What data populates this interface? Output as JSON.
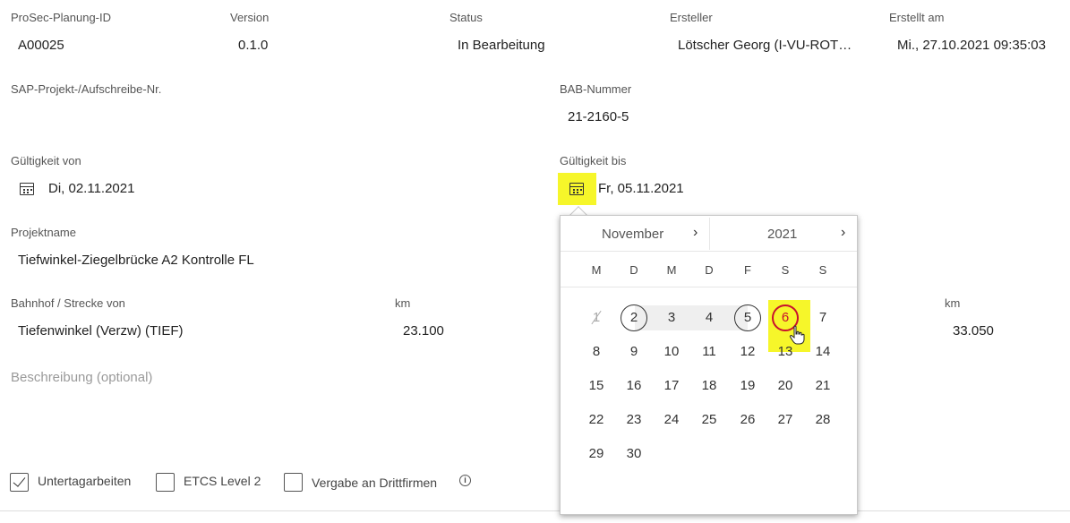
{
  "header_fields": {
    "planning_id": {
      "label": "ProSec-Planung-ID",
      "value": "A00025"
    },
    "version": {
      "label": "Version",
      "value": "0.1.0"
    },
    "status": {
      "label": "Status",
      "value": "In Bearbeitung"
    },
    "creator": {
      "label": "Ersteller",
      "value": "Lötscher Georg (I-VU-ROT…"
    },
    "created_at": {
      "label": "Erstellt am",
      "value": "Mi., 27.10.2021 09:35:03"
    }
  },
  "sap": {
    "label": "SAP-Projekt-/Aufschreibe-Nr.",
    "value": ""
  },
  "bab": {
    "label": "BAB-Nummer",
    "value": "21-2160-5"
  },
  "valid_from": {
    "label": "Gültigkeit von",
    "value": "Di, 02.11.2021",
    "icon": "calendar-icon"
  },
  "valid_to": {
    "label": "Gültigkeit bis",
    "value": "Fr, 05.11.2021",
    "icon": "calendar-icon"
  },
  "project_name": {
    "label": "Projektname",
    "value": "Tiefwinkel-Ziegelbrücke A2 Kontrolle FL"
  },
  "station_from": {
    "label": "Bahnhof / Strecke von",
    "value": "Tiefenwinkel (Verzw) (TIEF)"
  },
  "km_from": {
    "label": "km",
    "value": "23.100"
  },
  "km_to": {
    "label": "km",
    "value": "33.050"
  },
  "description": {
    "placeholder": "Beschreibung (optional)"
  },
  "checkboxes": [
    {
      "label": "Untertagarbeiten",
      "checked": true
    },
    {
      "label": "ETCS Level 2",
      "checked": false
    },
    {
      "label": "Vergabe an Drittfirmen",
      "checked": false
    }
  ],
  "info_icon": "info-icon",
  "calendar": {
    "month": "November",
    "year": "2021",
    "next_month_glyph": "›",
    "next_year_glyph": "›",
    "weekdays": [
      "M",
      "D",
      "M",
      "D",
      "F",
      "S",
      "S"
    ],
    "weeks": [
      [
        "1",
        "2",
        "3",
        "4",
        "5",
        "6",
        "7"
      ],
      [
        "8",
        "9",
        "10",
        "11",
        "12",
        "13",
        "14"
      ],
      [
        "15",
        "16",
        "17",
        "18",
        "19",
        "20",
        "21"
      ],
      [
        "22",
        "23",
        "24",
        "25",
        "26",
        "27",
        "28"
      ],
      [
        "29",
        "30"
      ]
    ],
    "disabled_day": "1",
    "range_start": "2",
    "range_end": "5",
    "hovered_day": "6",
    "highlight_color": "#f6f62a",
    "hover_ring_color": "#c8102e"
  }
}
